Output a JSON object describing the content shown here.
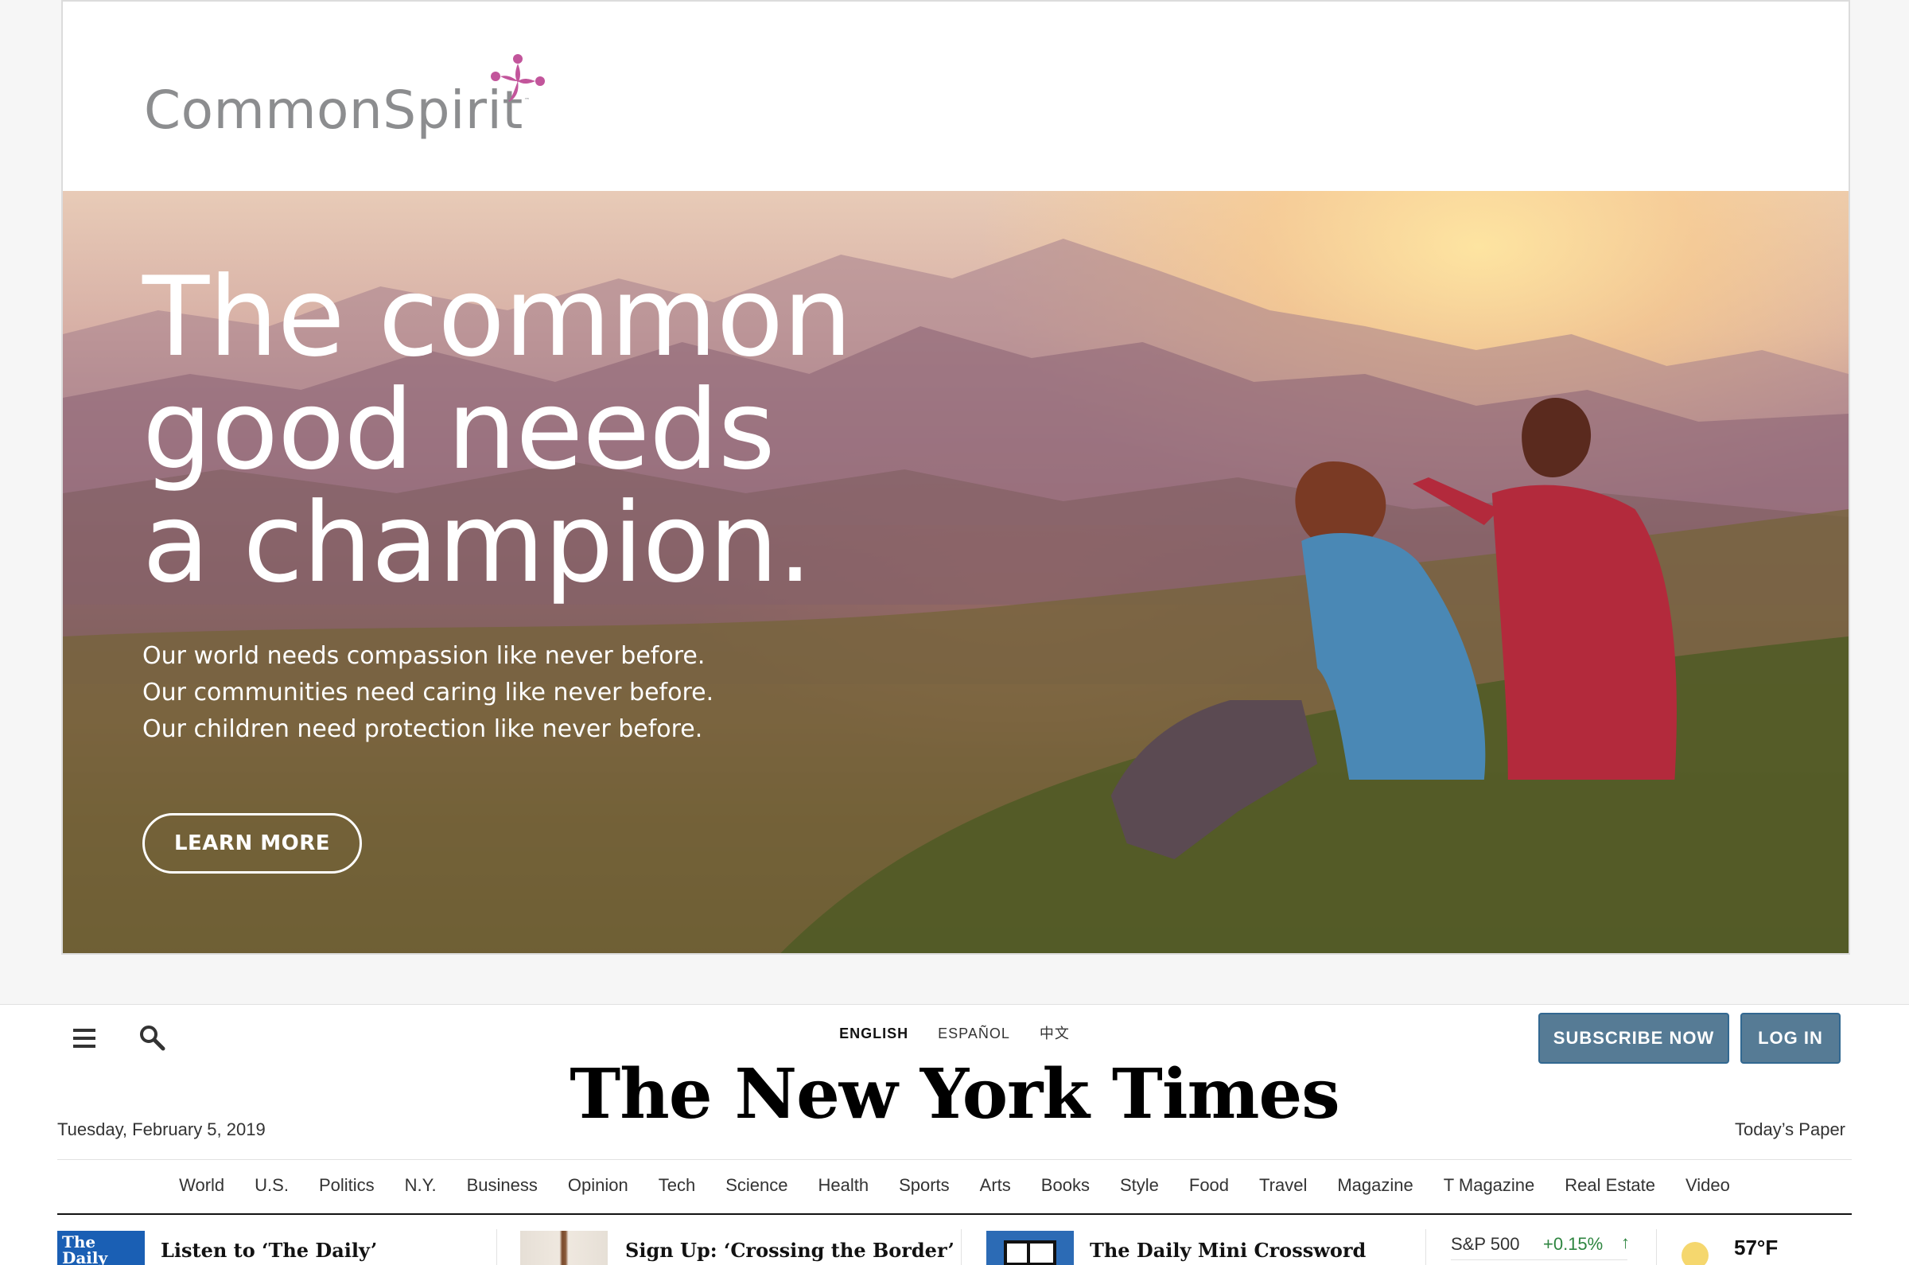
{
  "ad": {
    "brand_name": "CommonSpirit",
    "trademark": "™",
    "headline_lines": [
      "The common",
      "good needs",
      "a champion."
    ],
    "body_lines": [
      "Our world needs compassion like never before.",
      "Our communities need caring like never before.",
      "Our children need protection like never before."
    ],
    "cta_label": "LEARN MORE",
    "brand_color": "#c2559b"
  },
  "nyt": {
    "editions": {
      "english": "ENGLISH",
      "spanish": "ESPAÑOL",
      "chinese": "中文"
    },
    "subscribe_label": "SUBSCRIBE NOW",
    "login_label": "LOG IN",
    "masthead": "The New York Times",
    "date": "Tuesday, February 5, 2019",
    "todays_paper": "Today’s Paper",
    "nav": [
      "World",
      "U.S.",
      "Politics",
      "N.Y.",
      "Business",
      "Opinion",
      "Tech",
      "Science",
      "Health",
      "Sports",
      "Arts",
      "Books",
      "Style",
      "Food",
      "Travel",
      "Magazine",
      "T Magazine",
      "Real Estate",
      "Video"
    ],
    "strip": {
      "daily_badge": "The Daily",
      "daily_text": "Listen to ‘The Daily’",
      "border_text": "Sign Up: ‘Crossing the Border’",
      "crossword_text": "The Daily Mini Crossword",
      "market_label": "S&P 500",
      "market_value": "+0.15%",
      "market_arrow": "↑",
      "temperature": "57°F"
    },
    "button_color": "#567b95",
    "market_up_color": "#2e8540"
  }
}
